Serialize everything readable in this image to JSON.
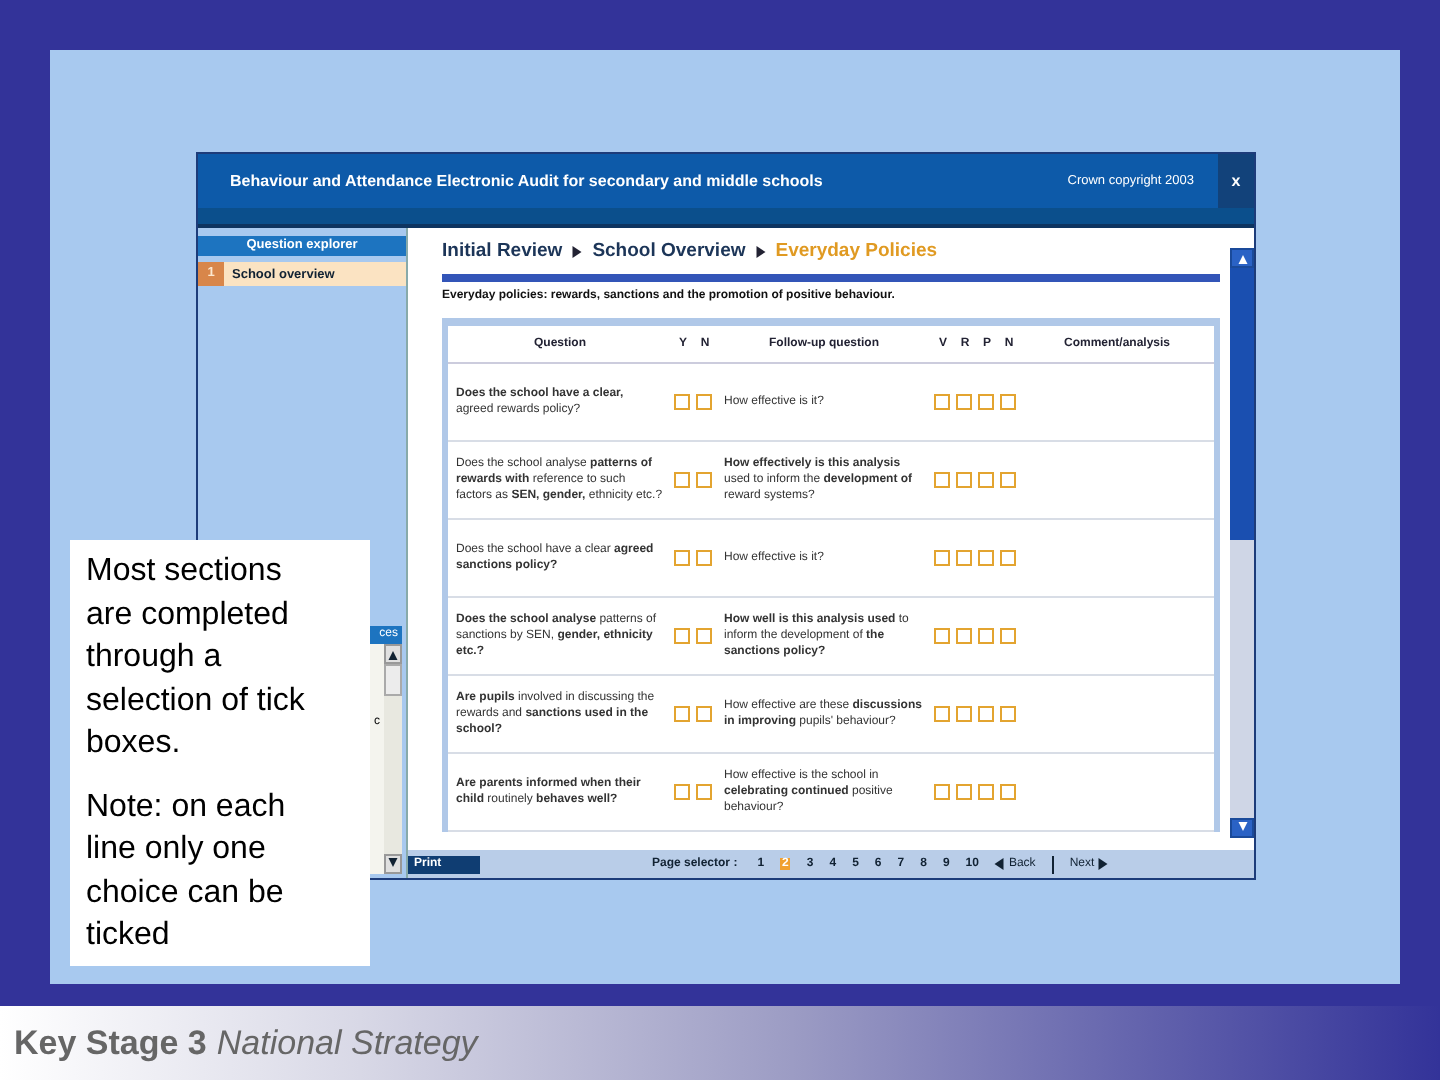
{
  "window": {
    "title": "Behaviour and Attendance Electronic Audit for secondary and middle schools",
    "copyright": "Crown copyright 2003",
    "close": "x"
  },
  "sidebar": {
    "header": "Question explorer",
    "items": [
      {
        "number": "1",
        "label": "School overview",
        "selected": true
      }
    ],
    "sub_panel": {
      "header": "ces",
      "text": "c"
    }
  },
  "breadcrumb": [
    {
      "label": "Initial Review",
      "current": false
    },
    {
      "label": "School Overview",
      "current": false
    },
    {
      "label": "Everyday Policies",
      "current": true
    }
  ],
  "intro": "Everyday policies: rewards, sanctions and the promotion of positive behaviour.",
  "table": {
    "columns": [
      "Question",
      "Y",
      "N",
      "Follow-up question",
      "V",
      "R",
      "P",
      "N",
      "Comment/analysis"
    ],
    "rows": [
      {
        "question": "**Does the school have a clear,** agreed rewards policy?",
        "yn": [
          {
            "checked": false
          },
          {
            "checked": false
          }
        ],
        "followup": "How effective is it?",
        "vrpn": [
          {
            "checked": false
          },
          {
            "checked": false
          },
          {
            "checked": false
          },
          {
            "checked": false
          }
        ]
      },
      {
        "question": "Does the school analyse **patterns of rewards with** reference to such factors as **SEN, gender,** ethnicity etc.?",
        "yn": [
          {
            "checked": false
          },
          {
            "checked": false
          }
        ],
        "followup": "**How effectively is this analysis** used to inform the **development of** reward systems?",
        "vrpn": [
          {
            "checked": false
          },
          {
            "checked": false
          },
          {
            "checked": false
          },
          {
            "checked": false
          }
        ]
      },
      {
        "question": "Does the school have a clear **agreed sanctions policy?**",
        "yn": [
          {
            "checked": false
          },
          {
            "checked": false
          }
        ],
        "followup": "How effective is it?",
        "vrpn": [
          {
            "checked": false
          },
          {
            "checked": false
          },
          {
            "checked": false
          },
          {
            "checked": false
          }
        ]
      },
      {
        "question": "**Does the school analyse** patterns of sanctions by SEN, **gender, ethnicity etc.?**",
        "yn": [
          {
            "checked": false
          },
          {
            "checked": false
          }
        ],
        "followup": "**How well is this analysis used** to inform the development of **the sanctions policy?**",
        "vrpn": [
          {
            "checked": false
          },
          {
            "checked": false
          },
          {
            "checked": false
          },
          {
            "checked": false
          }
        ]
      },
      {
        "question": "**Are pupils** involved in discussing the rewards and **sanctions used in the school?**",
        "yn": [
          {
            "checked": false
          },
          {
            "checked": false
          }
        ],
        "followup": "How effective are these **discussions in improving** pupils' behaviour?",
        "vrpn": [
          {
            "checked": false
          },
          {
            "checked": false
          },
          {
            "checked": false
          },
          {
            "checked": false
          }
        ]
      },
      {
        "question": "**Are parents informed when their child** routinely **behaves well?**",
        "yn": [
          {
            "checked": false
          },
          {
            "checked": false
          }
        ],
        "followup": "How effective is the school in **celebrating continued** positive behaviour?",
        "vrpn": [
          {
            "checked": false
          },
          {
            "checked": false
          },
          {
            "checked": false
          },
          {
            "checked": false
          }
        ]
      }
    ]
  },
  "footer": {
    "print": "Print",
    "page_selector_label": "Page selector :",
    "pages": [
      {
        "label": "1",
        "selected": false
      },
      {
        "label": "2",
        "selected": true
      },
      {
        "label": "3",
        "selected": false
      },
      {
        "label": "4",
        "selected": false
      },
      {
        "label": "5",
        "selected": false
      },
      {
        "label": "6",
        "selected": false
      },
      {
        "label": "7",
        "selected": false
      },
      {
        "label": "8",
        "selected": false
      },
      {
        "label": "9",
        "selected": false
      },
      {
        "label": "10",
        "selected": false
      }
    ],
    "back": "Back",
    "next": "Next"
  },
  "callout": [
    "Most sections are completed through a selection of tick boxes.",
    "Note: on each line only one choice can be ticked"
  ],
  "slide_footer": {
    "main": "Key Stage 3",
    "sub": "National Strategy"
  }
}
